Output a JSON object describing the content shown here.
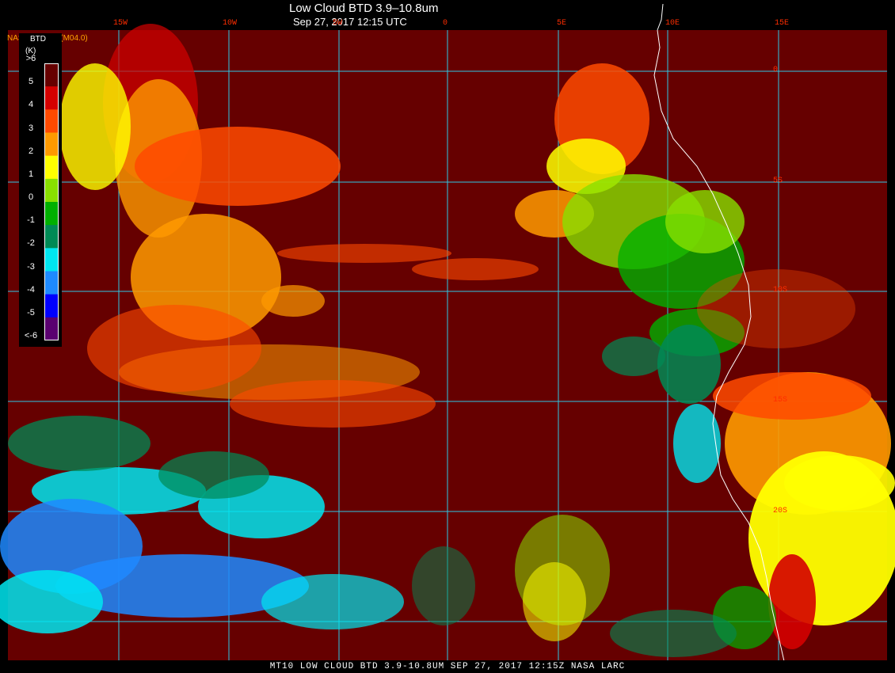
{
  "header": {
    "title": "Low Cloud BTD 3.9–10.8um",
    "time": "Sep 27, 2017 12:15 UTC",
    "producer": "NASA Langley (M04.0)"
  },
  "footer": {
    "caption": "MT10   LOW CLOUD BTD 3.9-10.8UM   SEP 27, 2017 12:15Z   NASA LARC"
  },
  "map": {
    "longitude_labels": [
      "15W",
      "10W",
      "5W",
      "0",
      "5E",
      "10E",
      "15E"
    ],
    "latitude_labels": [
      "0",
      "5S",
      "10S",
      "15S",
      "20S"
    ],
    "grid_color": "#2ec8e6",
    "background_color": "#660000",
    "coastline_color": "#ffffff"
  },
  "legend": {
    "title": "BTD",
    "unit": "(K)",
    "ticks": [
      ">6",
      "5",
      "4",
      "3",
      "2",
      "1",
      "0",
      "-1",
      "-2",
      "-3",
      "-4",
      "-5",
      "<-6"
    ],
    "colors": [
      "#660000",
      "#d40000",
      "#ff4a00",
      "#ff9a00",
      "#ffff00",
      "#88e000",
      "#00b000",
      "#008a55",
      "#00e6f0",
      "#1e8aff",
      "#0000ff",
      "#5a0070"
    ]
  }
}
